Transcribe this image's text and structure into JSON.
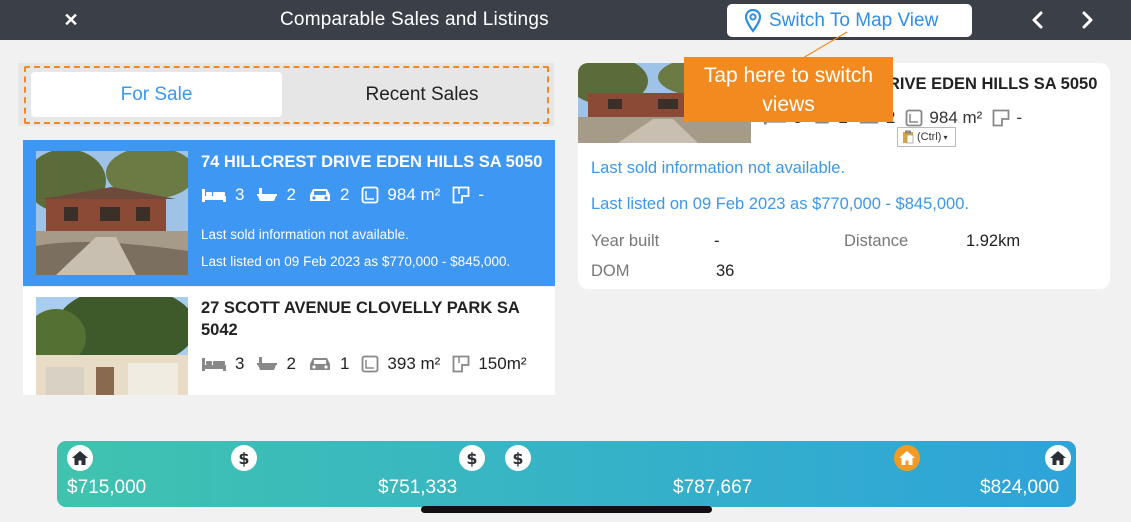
{
  "header": {
    "title": "Comparable Sales and Listings",
    "map_button_label": "Switch To Map View"
  },
  "tabs": [
    {
      "label": "For Sale",
      "active": true
    },
    {
      "label": "Recent Sales",
      "active": false
    }
  ],
  "listings": [
    {
      "address": "74 HILLCREST DRIVE EDEN HILLS SA 5050",
      "beds": "3",
      "baths": "2",
      "cars": "2",
      "land": "984 m²",
      "floor": "-",
      "sold_info": "Last sold information not available.",
      "listed_info": "Last listed on 09 Feb 2023 as $770,000 - $845,000.",
      "selected": true
    },
    {
      "address": "27 SCOTT AVENUE CLOVELLY PARK SA 5042",
      "beds": "3",
      "baths": "2",
      "cars": "1",
      "land": "393 m²",
      "floor": "150m²",
      "selected": false
    }
  ],
  "detail": {
    "address_visible": "RIVE EDEN HILLS SA 5050",
    "beds": "3",
    "baths": "2",
    "cars": "2",
    "land": "984 m²",
    "floor": "-",
    "sold_info": "Last sold information not available.",
    "listed_info": "Last listed on 09 Feb 2023 as $770,000 - $845,000.",
    "year_built_label": "Year built",
    "year_built_value": "-",
    "distance_label": "Distance",
    "distance_value": "1.92km",
    "dom_label": "DOM",
    "dom_value": "36"
  },
  "callout": {
    "text": "Tap here to switch views"
  },
  "paste_chip": {
    "label": "(Ctrl)"
  },
  "price_range": {
    "labels": [
      "$715,000",
      "$751,333",
      "$787,667",
      "$824,000"
    ],
    "dollar_symbol": "$",
    "colors": {
      "start": "#40c3ae",
      "end": "#2ea3da",
      "active_marker": "#f29b24"
    }
  },
  "colors": {
    "topbar": "#3b4048",
    "accent_blue": "#3e97f3",
    "callout_orange": "#f28a1f"
  }
}
